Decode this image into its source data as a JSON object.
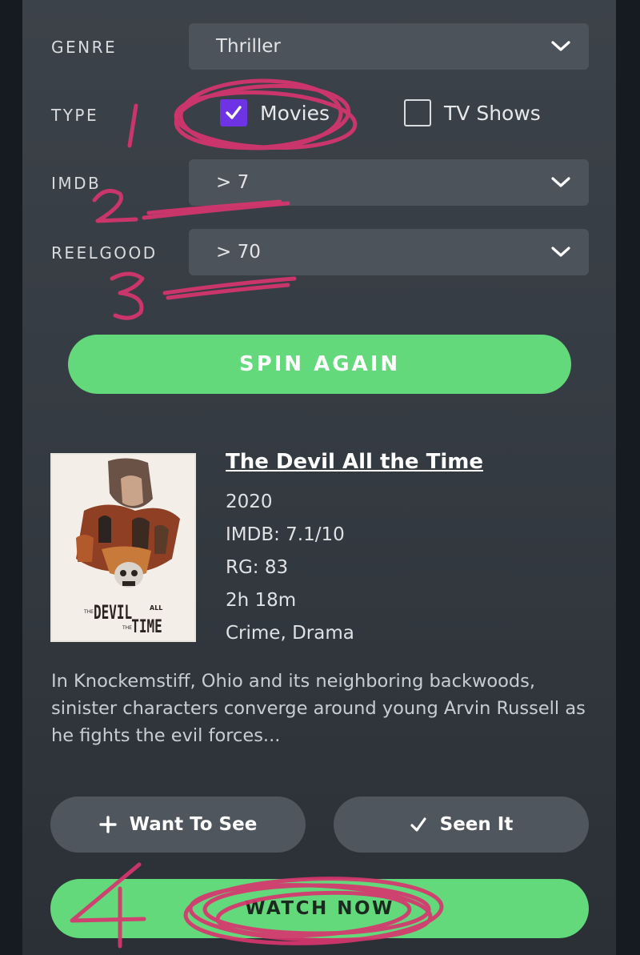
{
  "filters": {
    "genre": {
      "label": "GENRE",
      "value": "Thriller"
    },
    "type": {
      "label": "TYPE",
      "options": [
        {
          "label": "Movies",
          "checked": true
        },
        {
          "label": "TV Shows",
          "checked": false
        }
      ]
    },
    "imdb": {
      "label": "IMDB",
      "value": "> 7"
    },
    "reelgood": {
      "label": "REELGOOD",
      "value": "> 70"
    }
  },
  "spin_label": "SPIN AGAIN",
  "movie": {
    "poster_title_line1": "DEVIL",
    "poster_title_line2": "TIME",
    "poster_small_the": "THE",
    "poster_small_all": "ALL",
    "poster_small_the2": "THE",
    "title": "The Devil All the Time",
    "year": "2020",
    "imdb": "IMDB: 7.1/10",
    "rg": "RG: 83",
    "runtime": "2h 18m",
    "genres": "Crime, Drama",
    "description": "In Knockemstiff, Ohio and its neighboring backwoods, sinister characters converge around young Arvin Russell as he fights the evil forces..."
  },
  "actions": {
    "want_label": "Want To See",
    "seen_label": "Seen It",
    "watch_label": "WATCH NOW"
  },
  "annotations": {
    "n1": "1.",
    "n2": "2",
    "n3": "3",
    "n4": "4"
  },
  "colors": {
    "accent_green": "#63d97c",
    "checkbox_purple": "#6f33e6",
    "annotation_pink": "#d8356f"
  },
  "icons": {
    "select_caret": "chevron-down-icon",
    "checked": "checkmark-icon",
    "want": "plus-icon",
    "seen": "checkmark-icon"
  }
}
